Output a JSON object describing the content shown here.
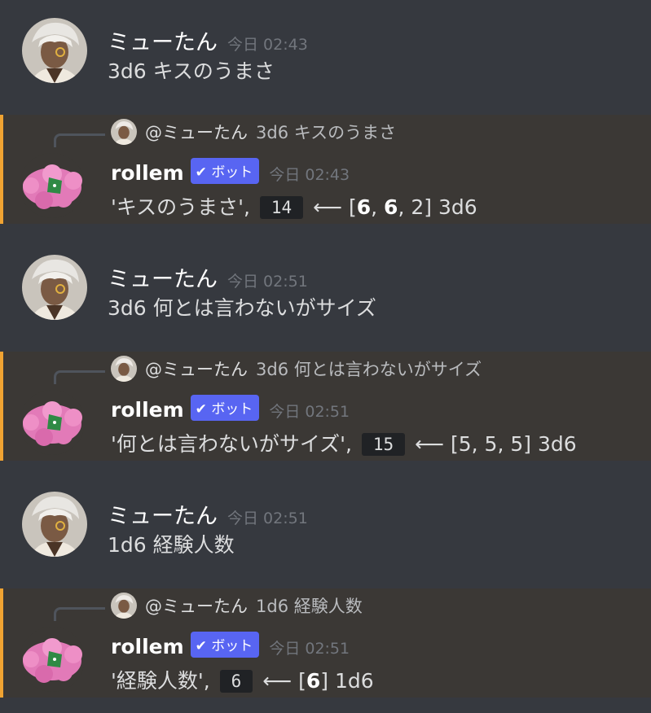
{
  "messages": [
    {
      "kind": "user",
      "author": "ミューたん",
      "time": "今日 02:43",
      "text": "3d6 キスのうまさ"
    },
    {
      "kind": "bot",
      "reply_mention": "@ミューたん",
      "reply_text": "3d6 キスのうまさ",
      "author": "rollem",
      "tag": "ボット",
      "time": "今日 02:43",
      "label": "'キスのうまさ',",
      "result": "14",
      "arrow": "⟵",
      "dice_open": "[",
      "dice": [
        "6",
        "6",
        "2"
      ],
      "dice_bold": [
        true,
        true,
        false
      ],
      "dice_close": "]",
      "expr": "3d6"
    },
    {
      "kind": "user",
      "author": "ミューたん",
      "time": "今日 02:51",
      "text": "3d6 何とは言わないがサイズ"
    },
    {
      "kind": "bot",
      "reply_mention": "@ミューたん",
      "reply_text": "3d6 何とは言わないがサイズ",
      "author": "rollem",
      "tag": "ボット",
      "time": "今日 02:51",
      "label": "'何とは言わないがサイズ',",
      "result": "15",
      "arrow": "⟵",
      "dice_open": "[",
      "dice": [
        "5",
        "5",
        "5"
      ],
      "dice_bold": [
        false,
        false,
        false
      ],
      "dice_close": "]",
      "expr": "3d6"
    },
    {
      "kind": "user",
      "author": "ミューたん",
      "time": "今日 02:51",
      "text": "1d6 経験人数"
    },
    {
      "kind": "bot",
      "reply_mention": "@ミューたん",
      "reply_text": "1d6 経験人数",
      "author": "rollem",
      "tag": "ボット",
      "time": "今日 02:51",
      "label": "'経験人数',",
      "result": "6",
      "arrow": "⟵",
      "dice_open": "[",
      "dice": [
        "6"
      ],
      "dice_bold": [
        true
      ],
      "dice_close": "]",
      "expr": "1d6"
    }
  ],
  "colors": {
    "background": "#36393f",
    "bot_message_bg": "#3b3835",
    "bot_accent": "#f0a332",
    "bot_tag": "#5865f2",
    "timestamp": "#72767d"
  },
  "icons": {
    "user_avatar": "silver-haired-character-avatar",
    "bot_avatar": "pink-fluffy-dice-avatar",
    "tag_check": "checkmark-icon"
  }
}
